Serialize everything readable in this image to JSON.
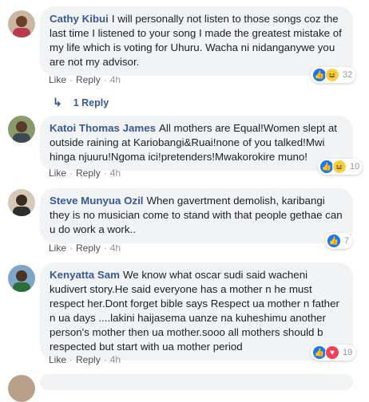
{
  "comments": [
    {
      "author": "Cathy Kibui",
      "text": "I will personally not listen to those songs coz the last time I listened to your song I made the greatest mistake of my life which is voting for Uhuru. Wacha ni nidanganywe you are not my advisor.",
      "like_label": "Like",
      "reply_label": "Reply",
      "time": "4h",
      "reaction_count": "32",
      "reactions": [
        "like-icon",
        "haha-icon"
      ]
    },
    {
      "author": "Katoi Thomas James",
      "text": "All mothers are Equal!Women slept at outside raining at Kariobangi&Ruai!none of you talked!Mwi hinga njuuru!Ngoma ici!pretenders!Mwakorokire muno!",
      "like_label": "Like",
      "reply_label": "Reply",
      "time": "4h",
      "reaction_count": "10",
      "reactions": [
        "like-icon",
        "haha-icon"
      ]
    },
    {
      "author": "Steve Munyua Ozil",
      "text": "When gavertment demolish, karibangi they is no musician come to stand with that people gethae can u do work a work..",
      "like_label": "Like",
      "reply_label": "Reply",
      "time": "4h",
      "reaction_count": "7",
      "reactions": [
        "like-icon"
      ]
    },
    {
      "author": "Kenyatta Sam",
      "text": "We know what oscar sudi said wacheni kudivert story.He said everyone has a mother n he must respect her.Dont forget bible says Respect ua mother n father n ua days ....lakini haijasema uanze na kuheshimu another person's mother then ua mother.sooo all mothers should b respected but start with ua mother period",
      "like_label": "Like",
      "reply_label": "Reply",
      "time": "4h",
      "reaction_count": "19",
      "reactions": [
        "like-icon",
        "love-icon"
      ]
    }
  ],
  "replies_link": "1 Reply",
  "colors": {
    "author": "#385898",
    "bubble": "#f2f3f5",
    "meta": "#90949c",
    "like": "#1877f2",
    "haha": "#f7d149",
    "love": "#f33e58"
  }
}
